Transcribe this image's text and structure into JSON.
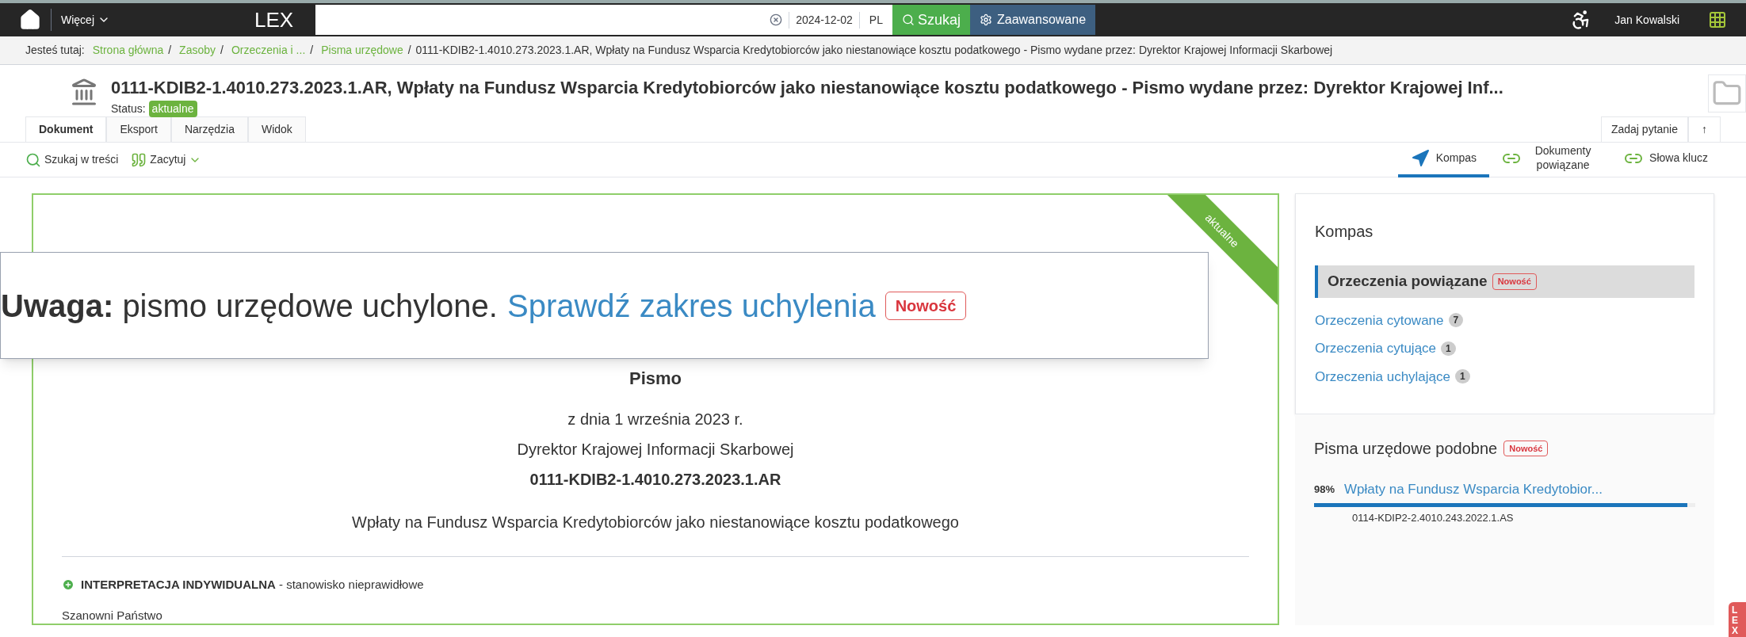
{
  "topbar": {
    "more": "Więcej",
    "logo": "LEX",
    "date": "2024-12-02",
    "lang": "PL",
    "search_button": "Szukaj",
    "advanced_button": "Zaawansowane",
    "user": "Jan Kowalski"
  },
  "breadcrumb": {
    "label": "Jesteś tutaj:",
    "links": [
      "Strona główna",
      "Zasoby",
      "Orzeczenia i ...",
      "Pisma urzędowe"
    ],
    "separator": "/",
    "current": "0111-KDIB2-1.4010.273.2023.1.AR, Wpłaty na Fundusz Wsparcia Kredytobiorców jako niestanowiące kosztu podatkowego - Pismo wydane przez: Dyrektor Krajowej Informacji Skarbowej"
  },
  "document": {
    "title": "0111-KDIB2-1.4010.273.2023.1.AR, Wpłaty na Fundusz Wsparcia Kredytobiorców jako niestanowiące kosztu podatkowego - Pismo wydane przez: Dyrektor Krajowej Inf...",
    "status_label": "Status:",
    "status": "aktualne"
  },
  "tabs": [
    {
      "label": "Dokument",
      "selected": true
    },
    {
      "label": "Eksport",
      "selected": false
    },
    {
      "label": "Narzędzia",
      "selected": false
    },
    {
      "label": "Widok",
      "selected": false
    }
  ],
  "right_buttons": [
    "Zadaj pytanie",
    "↑"
  ],
  "toolbar": {
    "search_in_text": "Szukaj w treści",
    "cite": "Zacytuj"
  },
  "side_tabs": [
    {
      "label": "Kompas",
      "selected": true
    },
    {
      "label": "Dokumenty powiązane",
      "selected": false
    },
    {
      "label": "Słowa klucz",
      "selected": false
    }
  ],
  "notice": {
    "prefix": "Uwaga:",
    "text": "pismo urzędowe uchylone.",
    "link": "Sprawdź zakres uchylenia",
    "badge": "Nowość"
  },
  "ribbon": "aktualne",
  "letter": {
    "heading": "Pismo",
    "date": "z dnia 1 września 2023 r.",
    "issuer": "Dyrektor Krajowej Informacji Skarbowej",
    "signature": "0111-KDIB2-1.4010.273.2023.1.AR",
    "subject": "Wpłaty na Fundusz Wsparcia Kredytobiorców jako niestanowiące kosztu podatkowego",
    "section": "**INTERPRETACJA INDYWIDUALNA** - stanowisko nieprawidłowe",
    "greeting": "Szanowni Państwo"
  },
  "kompas": {
    "title": "Kompas",
    "group": "Orzeczenia powiązane",
    "group_badge": "Nowość",
    "links": [
      {
        "label": "Orzeczenia cytowane",
        "count": "7"
      },
      {
        "label": "Orzeczenia cytujące",
        "count": "1"
      },
      {
        "label": "Orzeczenia uchylające",
        "count": "1"
      }
    ]
  },
  "similar": {
    "title": "Pisma urzędowe podobne",
    "badge": "Nowość",
    "items": [
      {
        "percent": "98%",
        "title": "Wpłaty na Fundusz Wsparcia Kredytobior...",
        "signature": "0114-KDIP2-2.4010.243.2022.1.AS",
        "level": 0.98
      }
    ]
  },
  "side_tab": "LEX"
}
